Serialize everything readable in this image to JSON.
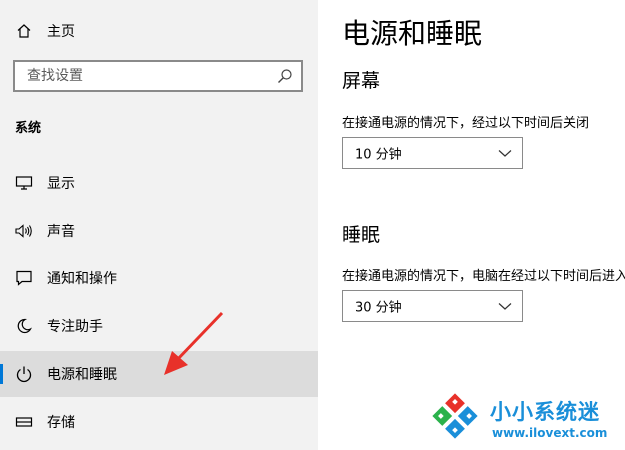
{
  "sidebar": {
    "home_label": "主页",
    "search_placeholder": "查找设置",
    "section_title": "系统",
    "items": [
      {
        "label": "显示",
        "icon": "monitor-icon"
      },
      {
        "label": "声音",
        "icon": "speaker-icon"
      },
      {
        "label": "通知和操作",
        "icon": "notification-icon"
      },
      {
        "label": "专注助手",
        "icon": "moon-icon"
      },
      {
        "label": "电源和睡眠",
        "icon": "power-icon",
        "selected": true
      },
      {
        "label": "存储",
        "icon": "storage-icon"
      }
    ]
  },
  "main": {
    "title": "电源和睡眠",
    "screen": {
      "heading": "屏幕",
      "description": "在接通电源的情况下，经过以下时间后关闭",
      "value": "10 分钟"
    },
    "sleep": {
      "heading": "睡眠",
      "description": "在接通电源的情况下，电脑在经过以下时间后进入睡眠状态",
      "value": "30 分钟"
    }
  },
  "watermark": {
    "brand": "小小系统迷",
    "url": "www.ilovext.com"
  },
  "colors": {
    "accent": "#0078d7",
    "sidebar_bg": "#f2f2f2",
    "selected_bg": "#dcdcdc",
    "annotation": "#e8312a",
    "watermark_blue": "#1a8fd9"
  }
}
